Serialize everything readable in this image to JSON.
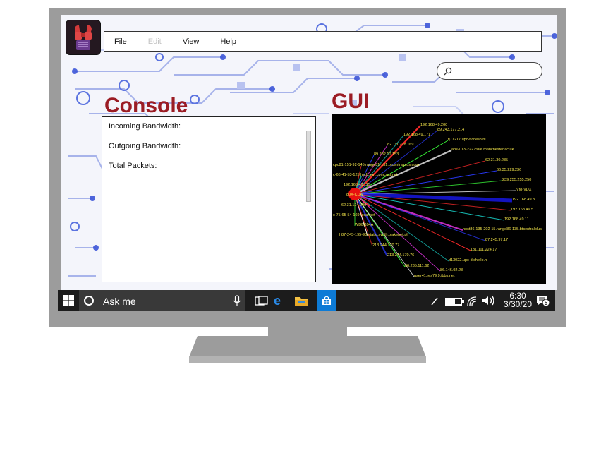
{
  "menu": {
    "file": "File",
    "edit": "Edit",
    "view": "View",
    "help": "Help"
  },
  "search": {
    "placeholder": ""
  },
  "console": {
    "heading": "Console",
    "incoming_label": "Incoming Bandwidth:",
    "outgoing_label": "Outgoing Bandwidth:",
    "total_packets_label": "Total Packets:"
  },
  "gui": {
    "heading": "GUI",
    "center_node": "80X-CDA",
    "node_labels": [
      "192.168.49.200",
      "89.243.177.214",
      "192.168.49.171",
      "fj77217.upc-f.chello.nl",
      "82.111.228.169",
      "abs-013-222.cslat.manchester.ac.uk",
      "89.232.10.153",
      "62.31.30.235",
      "cpc81-151-92-145.range81-151.btcentralplus.com",
      "66.35.229.236",
      "c-66-41-53-125.hsd1.mn.comcast.net",
      "239.255.255.250",
      "192.168.49.111",
      "VM-VDX",
      "192.168.49.3",
      "62.31.124.209",
      "192.168.49.5",
      "c-75-65-54-169.local.net",
      "192.168.49.11",
      "WDBK04A",
      "host86-135-202-15.range86-135.btcentralplus",
      "h87-245-195-93-static.synth.blakenet.pl",
      "87.245.97.17",
      "213.244.170.77",
      "131.111.224.17",
      "213.244.170.76",
      "d13022.upc-d.chello.nl",
      "66.235.111.62",
      "86.146.92.28",
      "user41.res79.9.jbbs.net"
    ]
  },
  "taskbar": {
    "search_text": "Ask me",
    "time": "6:30",
    "date": "3/30/20",
    "notification_count": "5"
  },
  "colors": {
    "heading": "#9b1c24",
    "taskbar": "#1c1c1c",
    "store_tile": "#0d7bd6",
    "bezel": "#9c9c9c",
    "node_label": "#f2e44a"
  }
}
